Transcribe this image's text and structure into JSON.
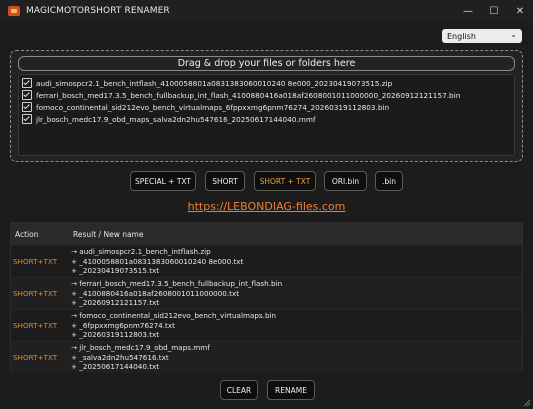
{
  "window": {
    "title": "MAGICMOTORSHORT RENAMER",
    "controls": [
      "—",
      "☐",
      "✕"
    ]
  },
  "language": {
    "selected": "English"
  },
  "dropzone": {
    "title": "Drag & drop your files or folders here",
    "files": [
      "audi_simospcr2.1_bench_intflash_4100058801a0831383060010240 8e000_20230419073515.zip",
      "ferrari_bosch_med17.3.5_bench_fullbackup_int_flash_4100880416a018af2608001011000000_20260912121157.bin",
      "fomoco_continental_sid212evo_bench_virtualmaps_6fppxxmg6pnm76274_20260319112803.bin",
      "jlr_bosch_medc17.9_obd_maps_salva2dn2hu547616_20250617144040.mmf"
    ]
  },
  "buttons": {
    "special_txt": "SPECIAL + TXT",
    "short": "SHORT",
    "short_txt": "SHORT + TXT",
    "ori_bin": "ORI.bin",
    "bin": ".bin",
    "clear": "CLEAR",
    "rename": "RENAME"
  },
  "link": "https://LEBONDIAG-files.com",
  "table": {
    "headers": {
      "action": "Action",
      "result": "Result / New name"
    },
    "rows": [
      {
        "action": "SHORT+TXT",
        "lines": [
          "→ audi_simospcr2.1_bench_intflash.zip",
          "+ _4100058801a0831383060010240 8e000.txt",
          "+ _20230419073515.txt"
        ]
      },
      {
        "action": "SHORT+TXT",
        "lines": [
          "→ ferrari_bosch_med17.3.5_bench_fullbackup_int_flash.bin",
          "+ _4100880416a018af2608001011000000.txt",
          "+ _20260912121157.txt"
        ]
      },
      {
        "action": "SHORT+TXT",
        "lines": [
          "→ fomoco_continental_sid212evo_bench_virtualmaps.bin",
          "+ _6fppxxmg6pnm76274.txt",
          "+ _20260319112803.txt"
        ]
      },
      {
        "action": "SHORT+TXT",
        "lines": [
          "→ jlr_bosch_medc17.9_obd_maps.mmf",
          "+ _salva2dn2hu547616.txt",
          "+ _20250617144040.txt"
        ]
      }
    ]
  },
  "colors": {
    "accent": "#f27f2e",
    "action": "#e08a2c",
    "background": "#1c1c1c"
  }
}
